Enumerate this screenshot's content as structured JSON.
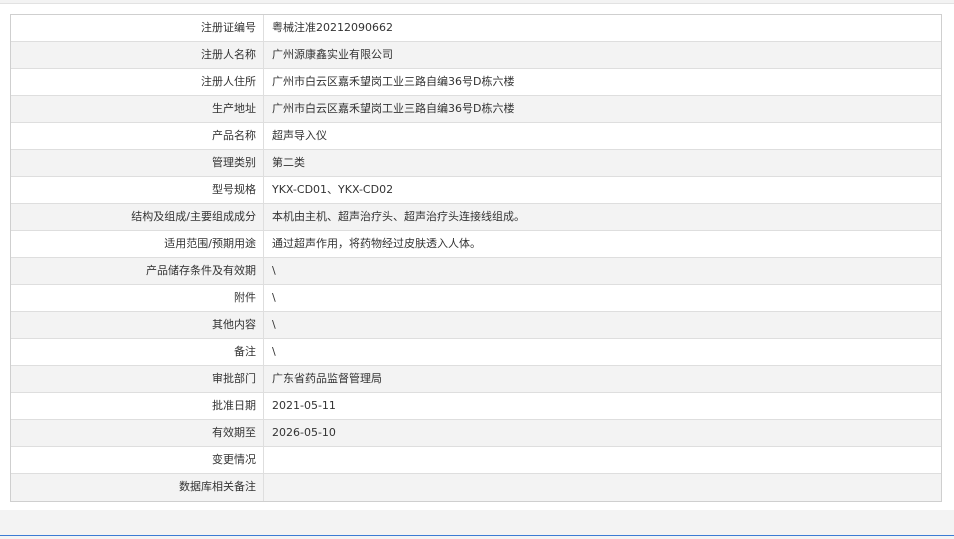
{
  "rows": [
    {
      "label": "注册证编号",
      "value": "粤械注准20212090662"
    },
    {
      "label": "注册人名称",
      "value": "广州源康鑫实业有限公司"
    },
    {
      "label": "注册人住所",
      "value": "广州市白云区嘉禾望岗工业三路自编36号D栋六楼"
    },
    {
      "label": "生产地址",
      "value": "广州市白云区嘉禾望岗工业三路自编36号D栋六楼"
    },
    {
      "label": "产品名称",
      "value": "超声导入仪"
    },
    {
      "label": "管理类别",
      "value": "第二类"
    },
    {
      "label": "型号规格",
      "value": "YKX-CD01、YKX-CD02"
    },
    {
      "label": "结构及组成/主要组成成分",
      "value": "本机由主机、超声治疗头、超声治疗头连接线组成。"
    },
    {
      "label": "适用范围/预期用途",
      "value": "通过超声作用，将药物经过皮肤透入人体。"
    },
    {
      "label": "产品储存条件及有效期",
      "value": "\\"
    },
    {
      "label": "附件",
      "value": "\\"
    },
    {
      "label": "其他内容",
      "value": "\\"
    },
    {
      "label": "备注",
      "value": "\\"
    },
    {
      "label": "审批部门",
      "value": "广东省药品监督管理局"
    },
    {
      "label": "批准日期",
      "value": "2021-05-11"
    },
    {
      "label": "有效期至",
      "value": "2026-05-10"
    },
    {
      "label": "变更情况",
      "value": ""
    },
    {
      "label": "数据库相关备注",
      "value": ""
    }
  ],
  "colors": {
    "alt_row": "#f3f3f3",
    "border": "#dedede",
    "text": "#333333",
    "accent_rule": "#3b7bd4"
  }
}
